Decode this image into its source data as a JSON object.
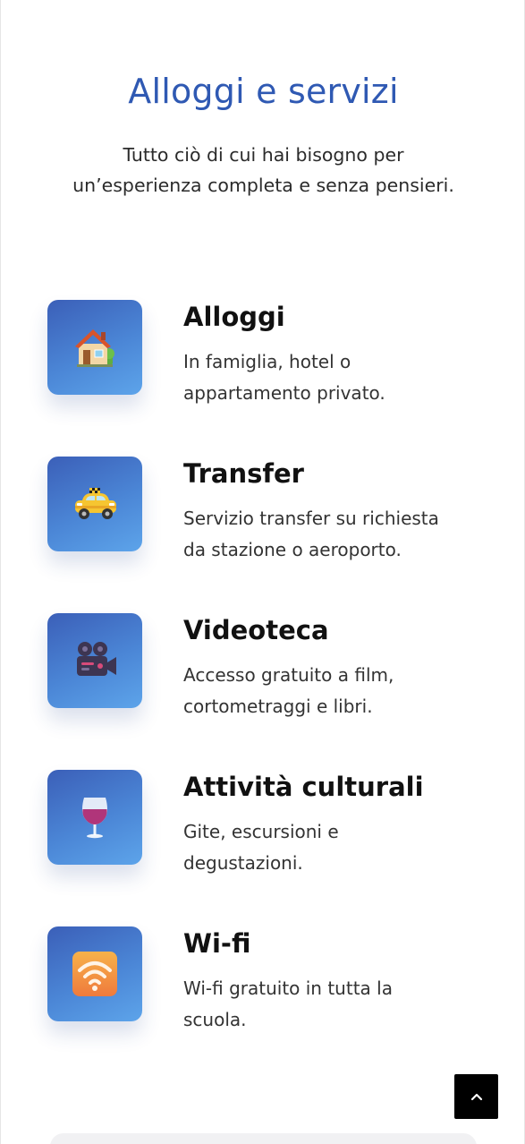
{
  "header": {
    "title": "Alloggi e servizi",
    "subtitle_line1": "Tutto ciò di cui hai bisogno per",
    "subtitle_line2": "un’esperienza completa e senza pensieri."
  },
  "services": [
    {
      "title": "Alloggi",
      "desc_line1": "In famiglia, hotel o",
      "desc_line2": "appartamento privato.",
      "icon": "house-icon"
    },
    {
      "title": "Transfer",
      "desc_line1": "Servizio transfer su richiesta",
      "desc_line2": "da stazione o aeroporto.",
      "icon": "taxi-icon"
    },
    {
      "title": "Videoteca",
      "desc_line1": "Accesso gratuito a film,",
      "desc_line2": "cortometraggi e libri.",
      "icon": "movie-camera-icon"
    },
    {
      "title": "Attività culturali",
      "desc_line1": "Gite, escursioni e",
      "desc_line2": "degustazioni.",
      "icon": "wine-glass-icon"
    },
    {
      "title": "Wi-fi",
      "desc_line1": "Wi-fi gratuito in tutta la",
      "desc_line2": "scuola.",
      "icon": "wifi-icon"
    }
  ],
  "colors": {
    "title": "#2f59b3",
    "icon_gradient_start": "#3b5fb8",
    "icon_gradient_end": "#5da4ea",
    "back_to_top_bg": "#000000"
  },
  "back_to_top": {
    "icon": "chevron-up-icon"
  }
}
